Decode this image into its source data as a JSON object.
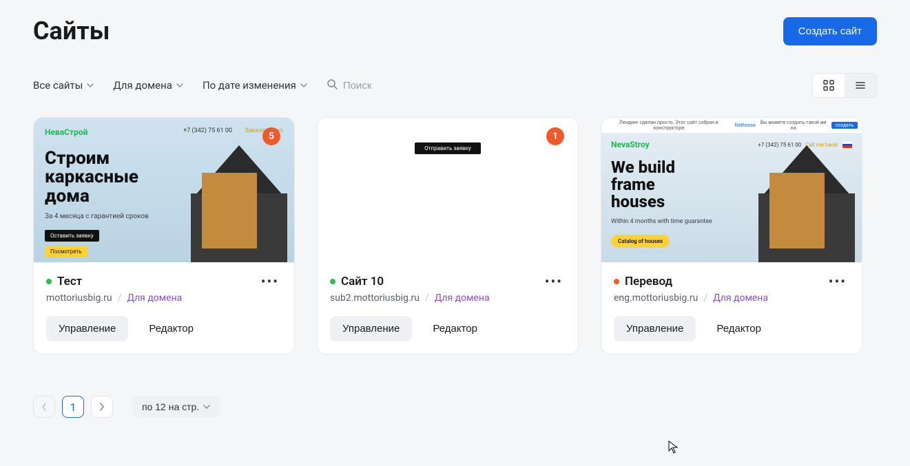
{
  "header": {
    "title": "Сайты",
    "create_button": "Создать сайт"
  },
  "filters": {
    "all_sites": "Все сайты",
    "for_domain": "Для домена",
    "sort": "По дате изменения",
    "search_placeholder": "Поиск"
  },
  "view": {
    "grid_active": true
  },
  "sites": [
    {
      "badge": "5",
      "status": "green",
      "name": "Тест",
      "domain": "mottoriusbig.ru",
      "domain_link": "Для домена",
      "manage": "Управление",
      "editor": "Редактор",
      "thumb": {
        "type": "ru",
        "logo": "НеваСтрой",
        "phone": "+7 (342) 75 61 00",
        "call": "Заказать зво",
        "h1_l1": "Строим",
        "h1_l2": "каркасные",
        "h1_l3": "дома",
        "sub": "За 4 месяца с гарантией сроков",
        "btn_dark": "Оставить заявку",
        "btn_yellow": "Посмотреть"
      }
    },
    {
      "badge": "1",
      "status": "green",
      "name": "Сайт 10",
      "domain": "sub2.mottoriusbig.ru",
      "domain_link": "Для домена",
      "manage": "Управление",
      "editor": "Редактор",
      "thumb": {
        "type": "dark",
        "btn_dark": "Отправить заявку"
      }
    },
    {
      "badge": "",
      "status": "orange",
      "name": "Перевод",
      "domain": "eng.mottoriusbig.ru",
      "domain_link": "Для домена",
      "manage": "Управление",
      "editor": "Редактор",
      "thumb": {
        "type": "en",
        "promo_a": "Лендинг сделан просто. Этот сайт собран в конструкторе",
        "promo_link": "Nethouse",
        "promo_b": "Вы можете создать такой же на",
        "promo_btn": "создать",
        "logo": "NevaStroy",
        "phone": "+7 (342) 75 61 00",
        "call": "Call me back!",
        "h1_l1": "We build",
        "h1_l2": "frame",
        "h1_l3": "houses",
        "sub": "Within 4 months with time guarantee",
        "btn_yellow": "Catalog of houses"
      }
    }
  ],
  "pagination": {
    "current": "1",
    "per_page": "по 12 на стр."
  }
}
